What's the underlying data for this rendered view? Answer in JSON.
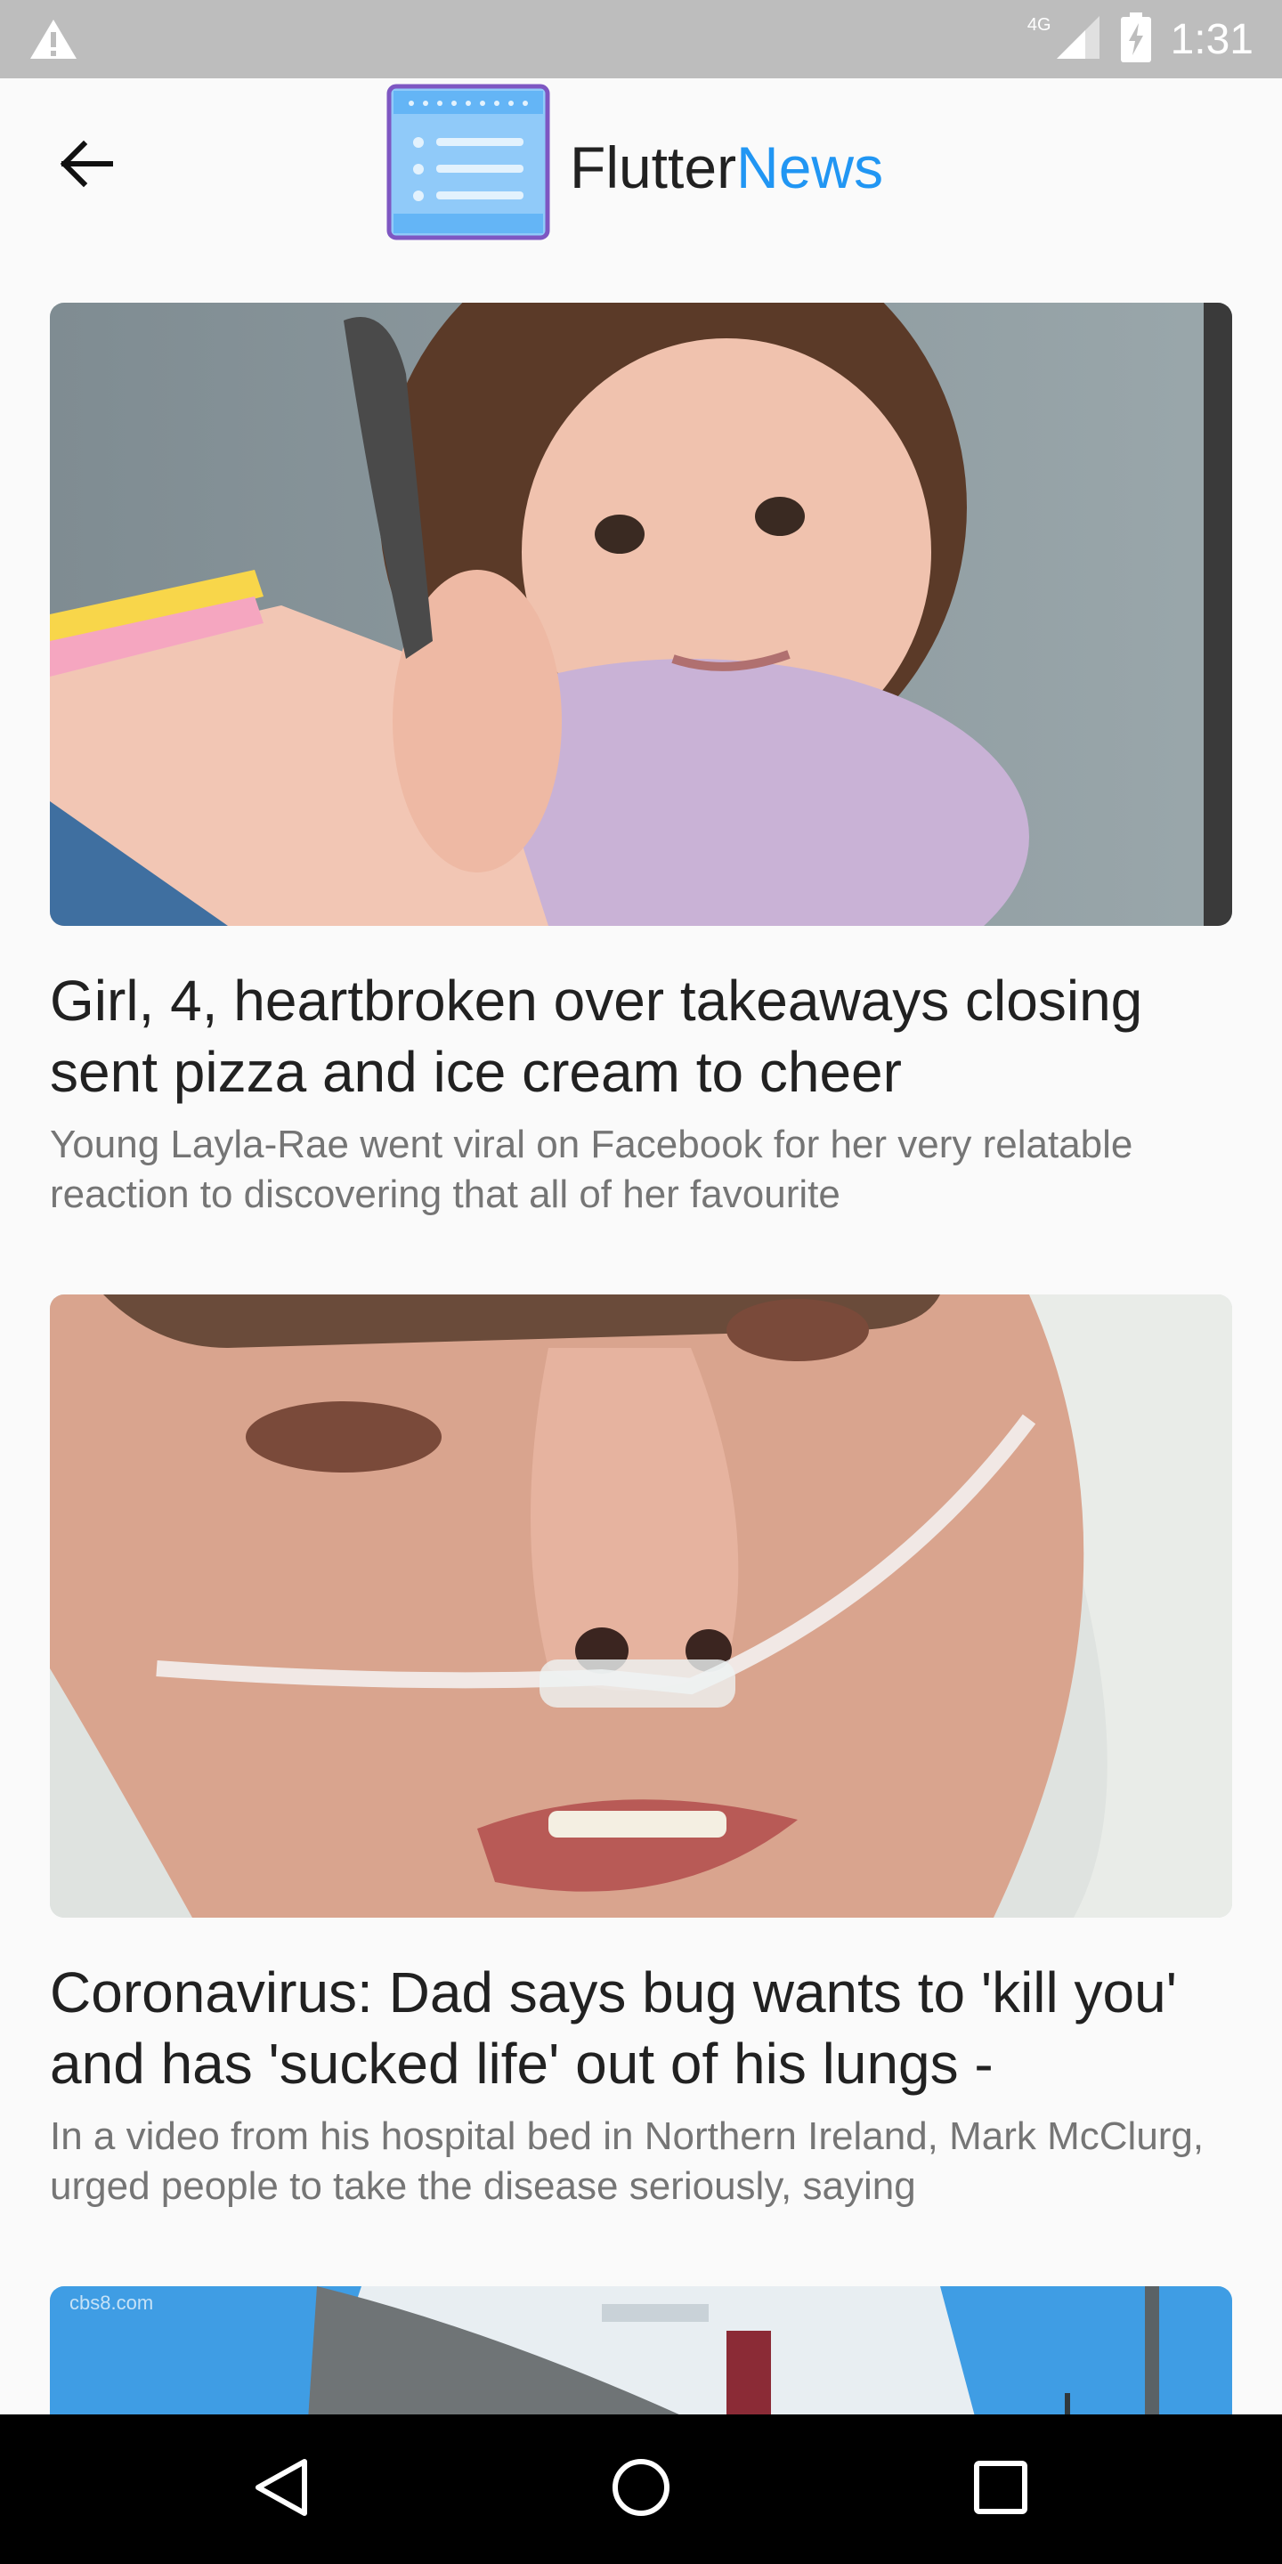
{
  "status_bar": {
    "network": "4G",
    "time": "1:31",
    "icons": [
      "warning-icon",
      "signal-icon",
      "battery-charging-icon"
    ]
  },
  "app_bar": {
    "back_icon": "arrow-back-icon",
    "logo_icon": "news-list-icon",
    "title_part1": "Flutter",
    "title_part2": "News",
    "accent_color": "#2196f3"
  },
  "articles": [
    {
      "title": "Girl, 4, heartbroken over takeaways closing sent pizza and ice cream to cheer",
      "description": "Young Layla-Rae went viral on Facebook for her very relatable reaction to discovering that all of her favourite"
    },
    {
      "title": "Coronavirus: Dad says bug wants to 'kill you' and has 'sucked life' out of his lungs -",
      "description": "In a video from his hospital bed in Northern Ireland, Mark McClurg, urged people to take the disease seriously, saying"
    },
    {
      "image_watermark": "cbs8.com"
    }
  ],
  "nav_bar": {
    "back": "nav-back-icon",
    "home": "nav-home-icon",
    "recents": "nav-recents-icon"
  }
}
